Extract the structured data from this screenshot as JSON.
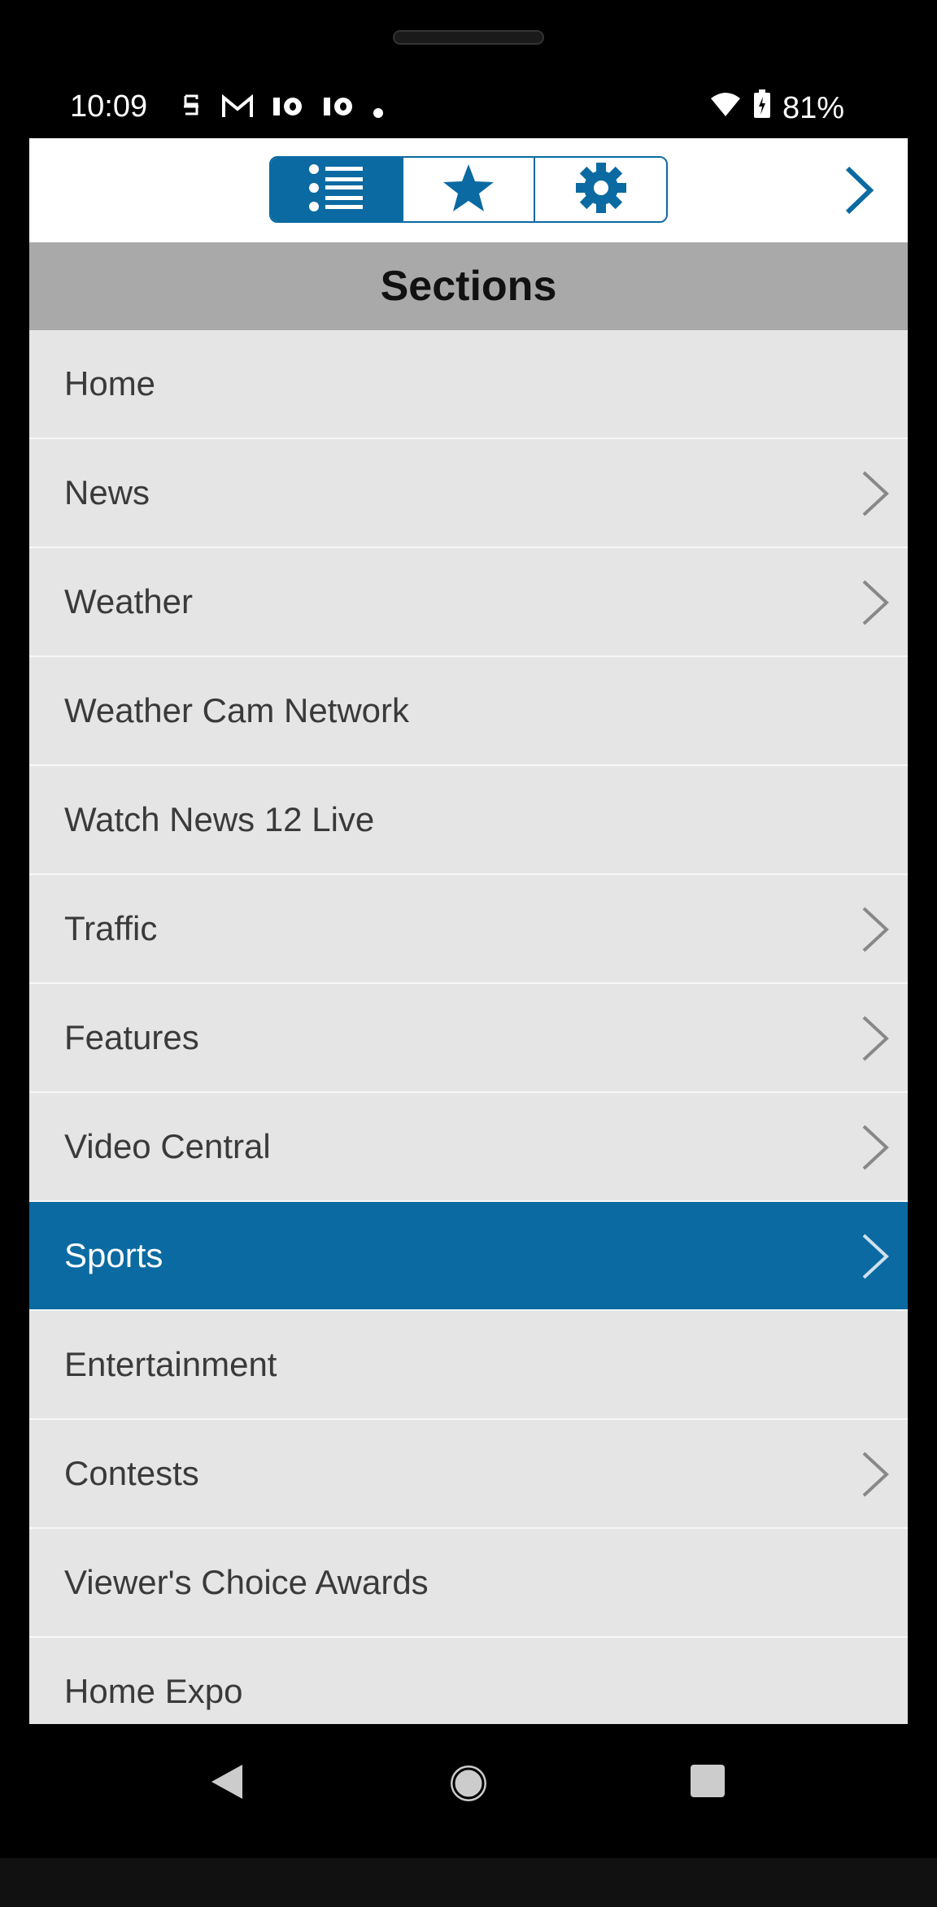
{
  "status": {
    "time": "10:09",
    "icons": [
      "s-icon",
      "gmail-icon",
      "10-icon",
      "10-icon",
      "dot-icon"
    ],
    "battery": "81%"
  },
  "toolbar": {
    "tabs": [
      {
        "name": "list-icon",
        "active": true
      },
      {
        "name": "star-icon",
        "active": false
      },
      {
        "name": "gear-icon",
        "active": false
      }
    ]
  },
  "header": {
    "title": "Sections"
  },
  "sections": [
    {
      "label": "Home",
      "chevron": false,
      "selected": false
    },
    {
      "label": "News",
      "chevron": true,
      "selected": false
    },
    {
      "label": "Weather",
      "chevron": true,
      "selected": false
    },
    {
      "label": "Weather Cam Network",
      "chevron": false,
      "selected": false
    },
    {
      "label": "Watch News 12 Live",
      "chevron": false,
      "selected": false
    },
    {
      "label": "Traffic",
      "chevron": true,
      "selected": false
    },
    {
      "label": "Features",
      "chevron": true,
      "selected": false
    },
    {
      "label": "Video Central",
      "chevron": true,
      "selected": false
    },
    {
      "label": "Sports",
      "chevron": true,
      "selected": true
    },
    {
      "label": "Entertainment",
      "chevron": false,
      "selected": false
    },
    {
      "label": "Contests",
      "chevron": true,
      "selected": false
    },
    {
      "label": "Viewer's Choice Awards",
      "chevron": false,
      "selected": false
    },
    {
      "label": "Home Expo",
      "chevron": false,
      "selected": false
    }
  ],
  "colors": {
    "accent": "#0b6aa2",
    "header_bg": "#a9a9a9",
    "row_bg": "#e5e5e5"
  }
}
